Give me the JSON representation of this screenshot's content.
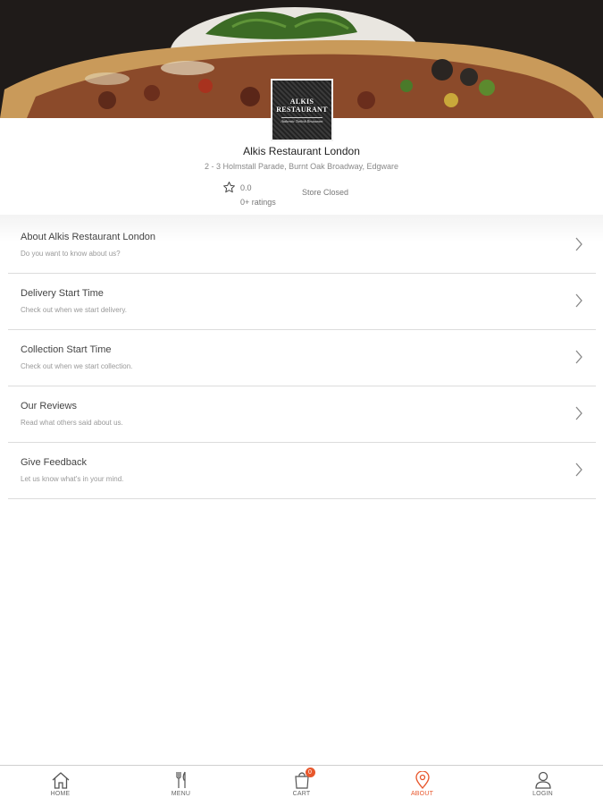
{
  "restaurant": {
    "logo_line1": "ALKIS",
    "logo_line2": "RESTAURANT",
    "logo_tagline": "Authentic Turkish Restaurant",
    "name": "Alkis Restaurant London",
    "address": "2 - 3 Holmstall Parade, Burnt Oak Broadway, Edgware",
    "rating_value": "0.0",
    "rating_count": "0+ ratings",
    "status": "Store Closed"
  },
  "menu_items": [
    {
      "title": "About Alkis Restaurant London",
      "subtitle": "Do you want to know about us?"
    },
    {
      "title": "Delivery Start Time",
      "subtitle": "Check out when we start delivery."
    },
    {
      "title": "Collection Start Time",
      "subtitle": "Check out when we start collection."
    },
    {
      "title": "Our Reviews",
      "subtitle": "Read what others said about us."
    },
    {
      "title": "Give Feedback",
      "subtitle": "Let us know what's in your mind."
    }
  ],
  "nav": {
    "home": "HOME",
    "menu": "MENU",
    "cart": "CART",
    "cart_count": "0",
    "about": "ABOUT",
    "login": "LOGIN",
    "active": "about"
  },
  "colors": {
    "accent": "#e8572c",
    "divider": "#dcdcdc"
  }
}
